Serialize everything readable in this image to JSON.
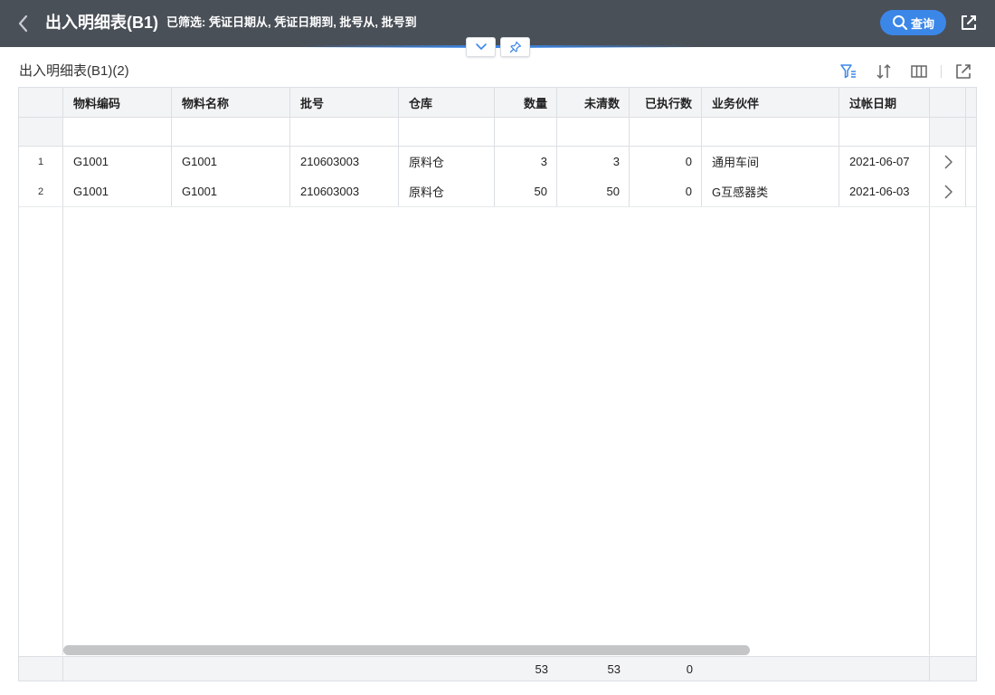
{
  "header": {
    "title": "出入明细表(B1)",
    "filter_label": "已筛选:",
    "filter_values": "凭证日期从, 凭证日期到, 批号从, 批号到",
    "query_label": "查询",
    "back_icon": "chevron-left-icon",
    "query_icon": "search-icon",
    "share_icon": "share-icon",
    "accent_color": "#3b87e8",
    "bg_color": "#4a5058"
  },
  "toolbar": {
    "list_title": "出入明细表(B1)(2)",
    "icons": [
      "filter-icon",
      "sort-icon",
      "columns-icon",
      "share-icon"
    ]
  },
  "grid": {
    "columns": [
      "物料编码",
      "物料名称",
      "批号",
      "仓库",
      "数量",
      "未清数",
      "已执行数",
      "业务伙伴",
      "过帐日期"
    ],
    "rows": [
      {
        "no": "1",
        "code": "G1001",
        "name": "G1001",
        "batch": "210603003",
        "warehouse": "原料仓",
        "qty": "3",
        "open": "3",
        "done": "0",
        "partner": "通用车间",
        "date": "2021-06-07"
      },
      {
        "no": "2",
        "code": "G1001",
        "name": "G1001",
        "batch": "210603003",
        "warehouse": "原料仓",
        "qty": "50",
        "open": "50",
        "done": "0",
        "partner": "G互感器类",
        "date": "2021-06-03"
      }
    ],
    "totals": {
      "qty": "53",
      "open": "53",
      "done": "0"
    }
  }
}
